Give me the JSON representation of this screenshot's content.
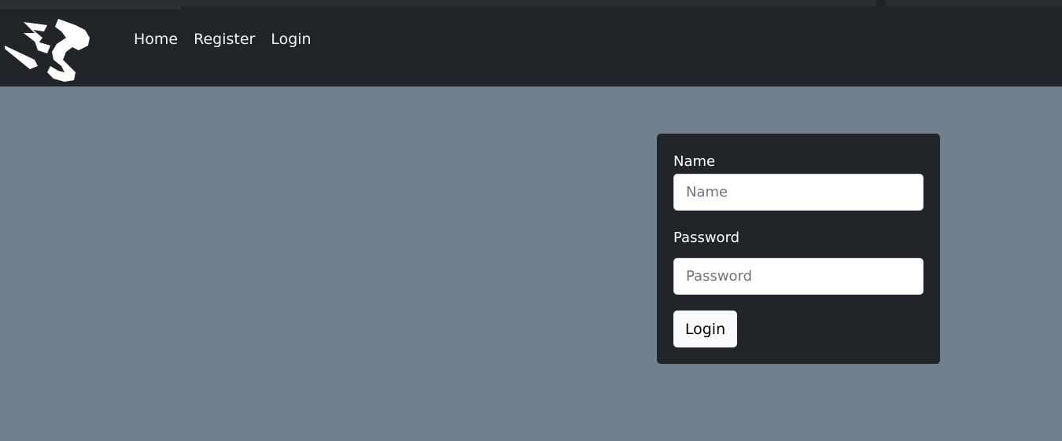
{
  "nav": {
    "logo": "dragon-logo-icon",
    "links": [
      {
        "label": "Home"
      },
      {
        "label": "Register"
      },
      {
        "label": "Login"
      }
    ]
  },
  "form": {
    "name": {
      "label": "Name",
      "placeholder": "Name",
      "value": ""
    },
    "password": {
      "label": "Password",
      "placeholder": "Password",
      "value": ""
    },
    "submit_label": "Login"
  },
  "colors": {
    "navbar": "#212529",
    "page_background": "#6f7f8e",
    "card": "#212529",
    "button": "#f8f9fa"
  }
}
